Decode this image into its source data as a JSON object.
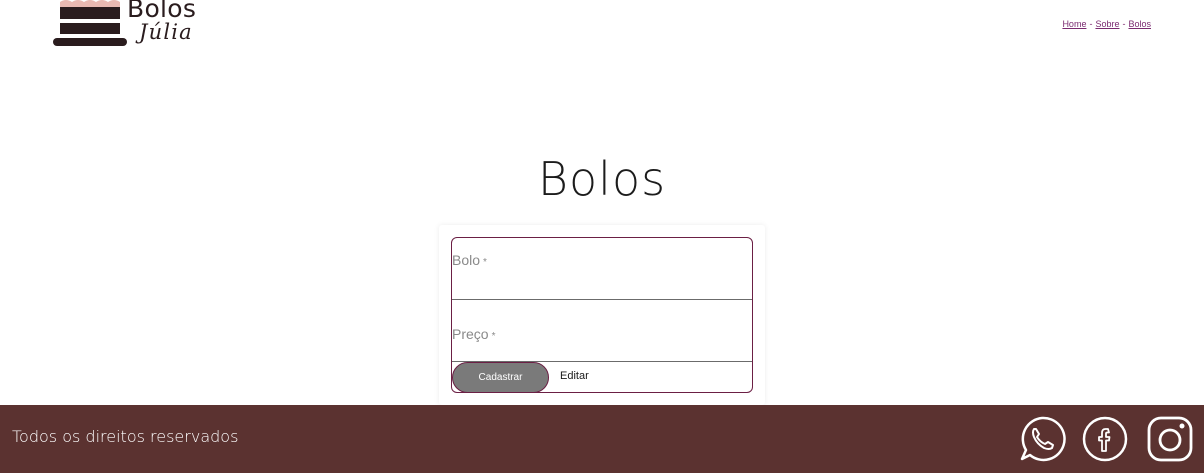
{
  "brand": {
    "line1": "Bolos",
    "line2": "Júlia"
  },
  "nav": {
    "items": [
      "Home",
      "Sobre",
      "Bolos"
    ],
    "separator": "-"
  },
  "page": {
    "title": "Bolos"
  },
  "form": {
    "field1_label": "Bolo",
    "field2_label": "Preço",
    "required_mark": "*",
    "submit_label": "Cadastrar",
    "edit_label": "Editar"
  },
  "footer": {
    "text": "Todos os direitos reservados",
    "icons": [
      "whatsapp-icon",
      "facebook-icon",
      "instagram-icon"
    ]
  },
  "colors": {
    "accent": "#6b1f44",
    "footer_bg": "#5b3230",
    "nav_link": "#7a2a70",
    "button_bg": "#7a7a7a"
  }
}
